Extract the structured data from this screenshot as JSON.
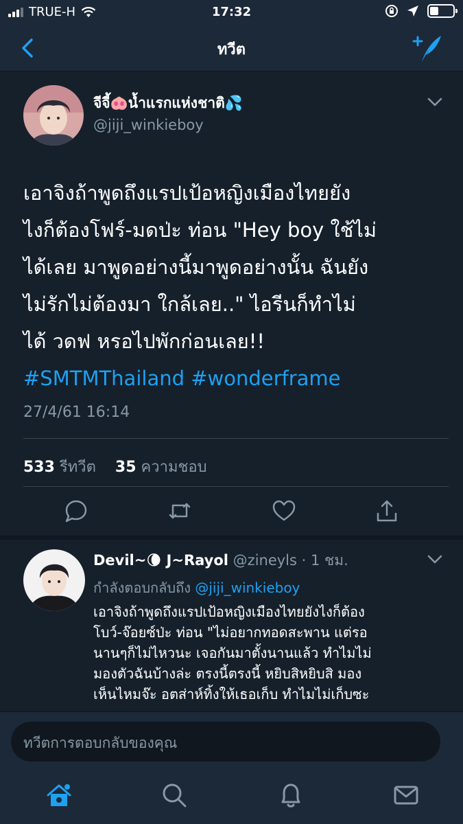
{
  "status_bar": {
    "carrier": "TRUE-H",
    "time": "17:32"
  },
  "nav": {
    "title": "ทวีต"
  },
  "tweet": {
    "display_name": "จีจี้🐽น้ำแรกแห่งชาติ💦",
    "handle": "@jiji_winkieboy",
    "text_lines": [
      "เอาจิงถ้าพูดถึงแรปเป้อหญิงเมืองไทยยัง",
      "ไงก็ต้องโฟร์-มดป่ะ ท่อน \"Hey boy  ใช้ไม่",
      "ได้เลย มาพูดอย่างนี้มาพูดอย่างนั้น ฉันยัง",
      "ไม่รักไม่ต้องมา ใกล้เลย..\" ไอรีนก็ทำไม่",
      "ได้ วดฟ หรอไปพักก่อนเลย!!"
    ],
    "hashtags": "#SMTMThailand #wonderframe",
    "timestamp": "27/4/61 16:14",
    "retweet_count": "533",
    "retweet_label": "รีทวีต",
    "like_count": "35",
    "like_label": "ความชอบ"
  },
  "reply": {
    "display_name": "Devil~🌘 J~Rayol",
    "handle_time": "@zineyls · 1 ชม.",
    "replying_prefix": "กำลังตอบกลับถึง",
    "replying_mention": "@jiji_winkieboy",
    "text_lines": [
      "เอาจิงถ้าพูดถึงแรปเป้อหญิงเมืองไทยยังไงก็ต้อง",
      "โบว์-จ๊อยซ์ป่ะ ท่อน \"ไม่อยากทอดสะพาน แต่รอ",
      "นานๆก็ไม่ไหวนะ เจอกันมาตั้งนานแล้ว ทำไมไม่",
      "มองตัวฉันบ้างล่ะ ตรงนี้ตรงนี้ หยิบสิหยิบสิ มอง",
      "เห็นไหมจ๊ะ อตส่าห์ทิ้งให้เธอเก็บ ทำไมไม่เก็บซะ"
    ]
  },
  "reply_bar": {
    "placeholder": "ทวีตการตอบกลับของคุณ"
  },
  "colors": {
    "background": "#15202b",
    "bar": "#1c2938",
    "accent": "#1da1f2",
    "muted": "#8899a6"
  },
  "icons": {
    "tabs": [
      "home-icon",
      "search-icon",
      "notifications-icon",
      "messages-icon"
    ],
    "actions": [
      "reply-icon",
      "retweet-icon",
      "like-icon",
      "share-icon"
    ]
  }
}
